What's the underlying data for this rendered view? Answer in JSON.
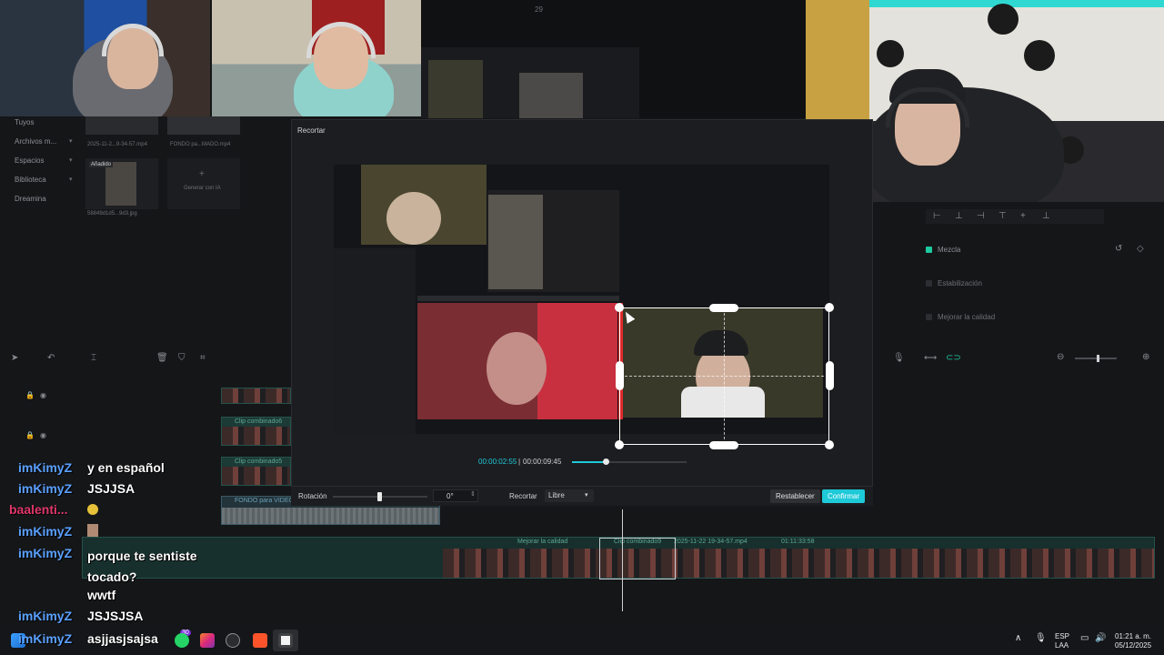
{
  "editor": {
    "top_counter": "29",
    "nav": [
      {
        "label": "Tuyos"
      },
      {
        "label": "Archivos m..."
      },
      {
        "label": "Espacios"
      },
      {
        "label": "Biblioteca"
      },
      {
        "label": "Dreamina"
      }
    ],
    "media": {
      "file1": "2025-11-2...9-34-57.mp4",
      "file2": "FONDO pa...MADO.mp4",
      "added_badge": "Añadido",
      "file3": "58849d1d5...9d3.jpg",
      "generate": "Generar con IA"
    },
    "right_panel": {
      "blend": "Mezcla",
      "stabilization": "Estabilización",
      "enhance": "Mejorar la calidad"
    },
    "tracks": [
      {
        "label": "Clip combinado6"
      },
      {
        "label": "Clip combinado5"
      },
      {
        "label": "FONDO para VIDEO"
      },
      {
        "label": "2025-11-22 19-34-57.mp4"
      }
    ],
    "main_track": {
      "label1": "Mejorar la calidad",
      "label2": "Clip combinado9",
      "label3": "2025-11-22 19-34-57.mp4",
      "label4": "01:11:33:58"
    }
  },
  "crop_dialog": {
    "title": "Recortar",
    "current_time": "00:00:02:55",
    "total_time": "00:00:09:45",
    "rotation_label": "Rotación",
    "rotation_value": "0°",
    "crop_label": "Recortar",
    "crop_mode": "Libre",
    "reset_label": "Restablecer",
    "confirm_label": "Confirmar",
    "accent_color": "#1ec9d8"
  },
  "chat": [
    {
      "user": "imKimyZ",
      "msg": "y en español",
      "color": "#5aa0ff"
    },
    {
      "user": "imKimyZ",
      "msg": "JSJJSA",
      "color": "#5aa0ff"
    },
    {
      "user": "baalenti...",
      "msg": "",
      "color": "#e0366a"
    },
    {
      "user": "imKimyZ",
      "msg": "",
      "color": "#5aa0ff"
    },
    {
      "user": "imKimyZ",
      "msg": "porque te sentiste tocado?",
      "color": "#5aa0ff"
    },
    {
      "user": "",
      "msg": "wwtf",
      "color": "#5aa0ff"
    },
    {
      "user": "imKimyZ",
      "msg": "JSJSJSA",
      "color": "#5aa0ff"
    },
    {
      "user": "imKimyZ",
      "msg": "asjjasjsajsa",
      "color": "#5aa0ff"
    }
  ],
  "taskbar": {
    "badge_count": "30",
    "lang_top": "ESP",
    "lang_bottom": "LAA",
    "time": "01:21 a. m.",
    "date": "05/12/2025"
  }
}
